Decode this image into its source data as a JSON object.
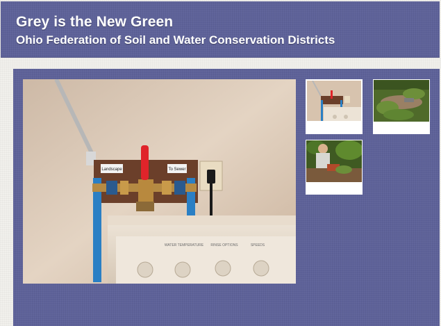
{
  "header": {
    "title": "Grey is the New Green",
    "subtitle": "Ohio Federation of Soil and Water Conservation Districts"
  },
  "gallery": {
    "main_photo": {
      "description_icon": "photo-washer-greywater-valve",
      "tag_left": "Landscape",
      "tag_right": "To Sewer",
      "panel_labels": [
        "WATER TEMPERATURE",
        "RINSE OPTIONS",
        "SPEEDS"
      ]
    },
    "thumbnails": [
      {
        "icon": "photo-valve-thumb",
        "selected": true
      },
      {
        "icon": "photo-garden-thumb",
        "selected": false
      },
      {
        "icon": "photo-gardener-thumb",
        "selected": false
      }
    ]
  },
  "colors": {
    "header_bg": "#5e6299",
    "page_bg": "#f1f0ec",
    "text": "#ffffff",
    "valve_red": "#e0242a",
    "pipe_blue": "#2a7fc4"
  }
}
